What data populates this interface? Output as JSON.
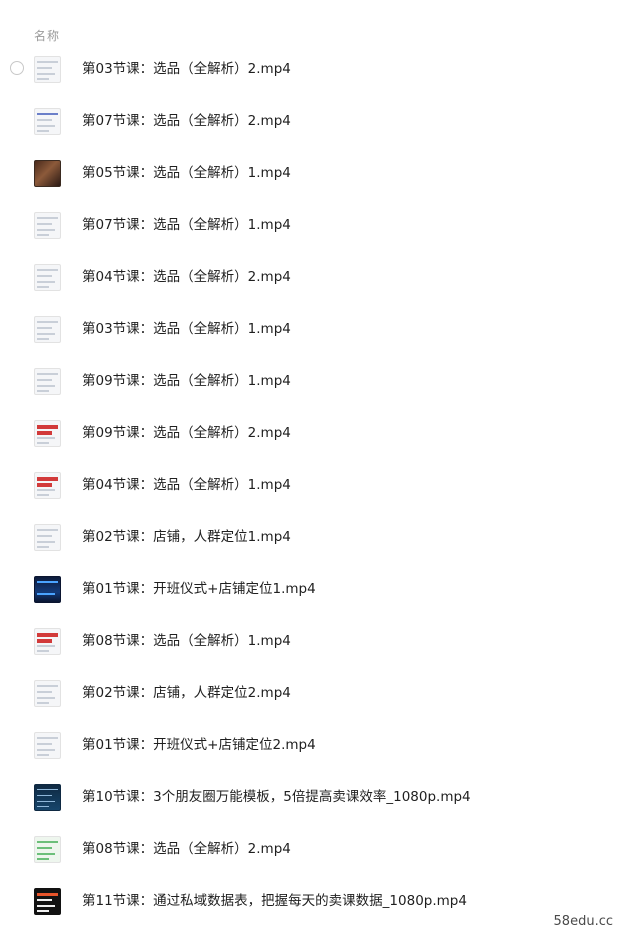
{
  "header": {
    "name_label": "名称"
  },
  "files": [
    {
      "name": "第03节课：选品（全解析）2.mp4",
      "thumb": "doc-thumbnail"
    },
    {
      "name": "第07节课：选品（全解析）2.mp4",
      "thumb": "doc-thumbnail-blue"
    },
    {
      "name": "第05节课：选品（全解析）1.mp4",
      "thumb": "photo-thumbnail"
    },
    {
      "name": "第07节课：选品（全解析）1.mp4",
      "thumb": "doc-thumbnail"
    },
    {
      "name": "第04节课：选品（全解析）2.mp4",
      "thumb": "doc-thumbnail"
    },
    {
      "name": "第03节课：选品（全解析）1.mp4",
      "thumb": "doc-thumbnail"
    },
    {
      "name": "第09节课：选品（全解析）1.mp4",
      "thumb": "doc-thumbnail"
    },
    {
      "name": "第09节课：选品（全解析）2.mp4",
      "thumb": "doc-thumbnail-red"
    },
    {
      "name": "第04节课：选品（全解析）1.mp4",
      "thumb": "doc-thumbnail-red"
    },
    {
      "name": "第02节课：店铺，人群定位1.mp4",
      "thumb": "doc-thumbnail"
    },
    {
      "name": "第01节课：开班仪式+店铺定位1.mp4",
      "thumb": "dark-thumbnail"
    },
    {
      "name": "第08节课：选品（全解析）1.mp4",
      "thumb": "doc-thumbnail-red"
    },
    {
      "name": "第02节课：店铺，人群定位2.mp4",
      "thumb": "doc-thumbnail"
    },
    {
      "name": "第01节课：开班仪式+店铺定位2.mp4",
      "thumb": "doc-thumbnail"
    },
    {
      "name": "第10节课：3个朋友圈万能模板，5倍提高卖课效率_1080p.mp4",
      "thumb": "navy-thumbnail"
    },
    {
      "name": "第08节课：选品（全解析）2.mp4",
      "thumb": "green-thumbnail"
    },
    {
      "name": "第11节课：通过私域数据表，把握每天的卖课数据_1080p.mp4",
      "thumb": "black-thumbnail"
    }
  ],
  "watermark": "58edu.cc"
}
